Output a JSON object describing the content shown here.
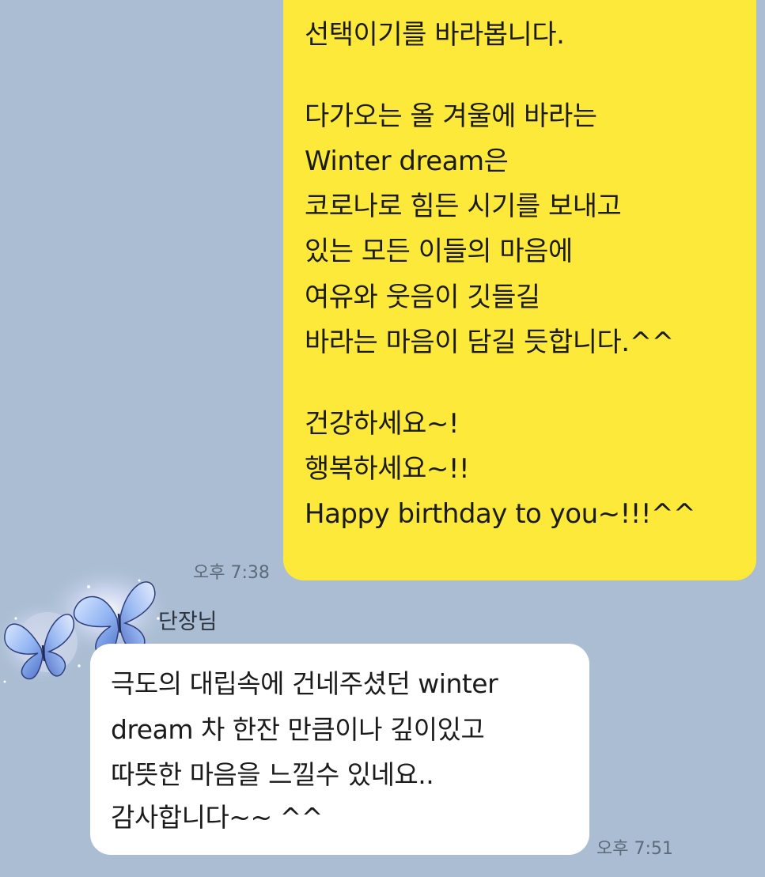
{
  "outgoing_message": {
    "lines": [
      "선택이기를 바라봅니다.",
      "다가오는 올 겨울에 바라는",
      "Winter dream은",
      "코로나로 힘든 시기를 보내고",
      "있는 모든 이들의 마음에",
      "여유와 웃음이 깃들길",
      "바라는 마음이 담길 듯합니다.^^",
      "건강하세요~!",
      "행복하세요~!!",
      "Happy birthday to you~!!!^^"
    ],
    "time": "오후 7:38",
    "bubble_color": "#fde93a"
  },
  "incoming_message": {
    "sender": "단장님",
    "avatar_icon": "butterfly-icon",
    "lines": [
      "극도의 대립속에 건네주셨던 winter",
      "dream 차 한잔 만큼이나 깊이있고",
      "따뜻한 마음을 느낄수 있네요..",
      "감사합니다~~ ^^"
    ],
    "time": "오후 7:51",
    "bubble_color": "#ffffff"
  },
  "background_color": "#aabdd3"
}
